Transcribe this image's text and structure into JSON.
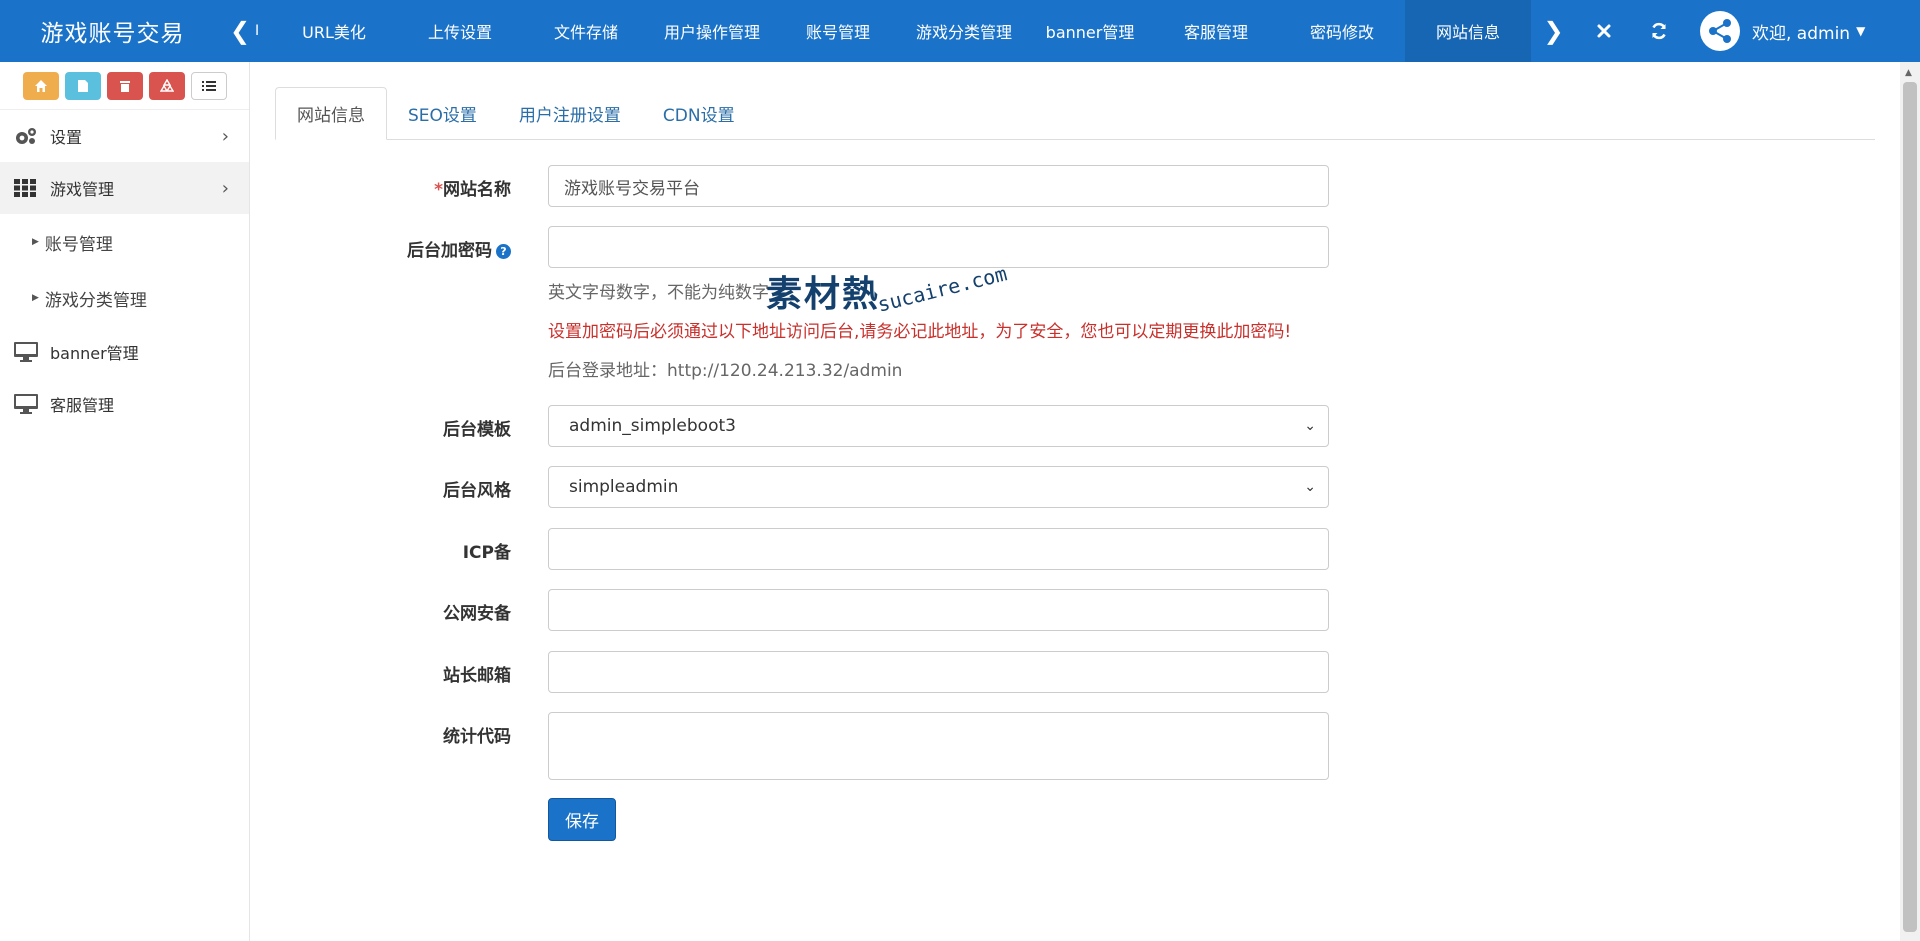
{
  "header": {
    "brand": "游戏账号交易",
    "clipped_tab": "I",
    "tabs": [
      "URL美化",
      "上传设置",
      "文件存储",
      "用户操作管理",
      "账号管理",
      "游戏分类管理",
      "banner管理",
      "客服管理",
      "密码修改",
      "网站信息"
    ],
    "active_tab_index": 9,
    "user_greeting": "欢迎, admin"
  },
  "sidebar": {
    "shortcuts": [
      "home-icon",
      "file-icon",
      "trash-icon",
      "recycle-icon",
      "list-icon"
    ],
    "items": [
      {
        "label": "设置",
        "icon": "gears-icon",
        "has_arrow": true
      },
      {
        "label": "游戏管理",
        "icon": "grid-icon",
        "has_arrow": true,
        "active": true
      },
      {
        "label": "账号管理",
        "sub": true
      },
      {
        "label": "游戏分类管理",
        "sub": true
      },
      {
        "label": "banner管理",
        "icon": "monitor-icon"
      },
      {
        "label": "客服管理",
        "icon": "monitor-icon"
      }
    ]
  },
  "tabs": [
    {
      "label": "网站信息",
      "active": true
    },
    {
      "label": "SEO设置"
    },
    {
      "label": "用户注册设置"
    },
    {
      "label": "CDN设置"
    }
  ],
  "form": {
    "site_name": {
      "label": "网站名称",
      "required_mark": "*",
      "value": "游戏账号交易平台"
    },
    "admin_password": {
      "label": "后台加密码",
      "value": "",
      "hint": "英文字母数字，不能为纯数字",
      "warning": "设置加密码后必须通过以下地址访问后台,请务必记此地址，为了安全，您也可以定期更换此加密码!",
      "login_url": "后台登录地址：http://120.24.213.32/admin"
    },
    "admin_template": {
      "label": "后台模板",
      "value": "admin_simpleboot3"
    },
    "admin_style": {
      "label": "后台风格",
      "value": "simpleadmin"
    },
    "icp": {
      "label": "ICP备",
      "value": ""
    },
    "police_record": {
      "label": "公网安备",
      "value": ""
    },
    "webmaster_email": {
      "label": "站长邮箱",
      "value": ""
    },
    "analytics_code": {
      "label": "统计代码",
      "value": ""
    },
    "save_label": "保存"
  },
  "watermark": {
    "zh": "素材熱",
    "en": "sucaire.com"
  },
  "colors": {
    "header": "#1a73c8",
    "primary": "#1a73c8",
    "warning_text": "#c9302c"
  }
}
